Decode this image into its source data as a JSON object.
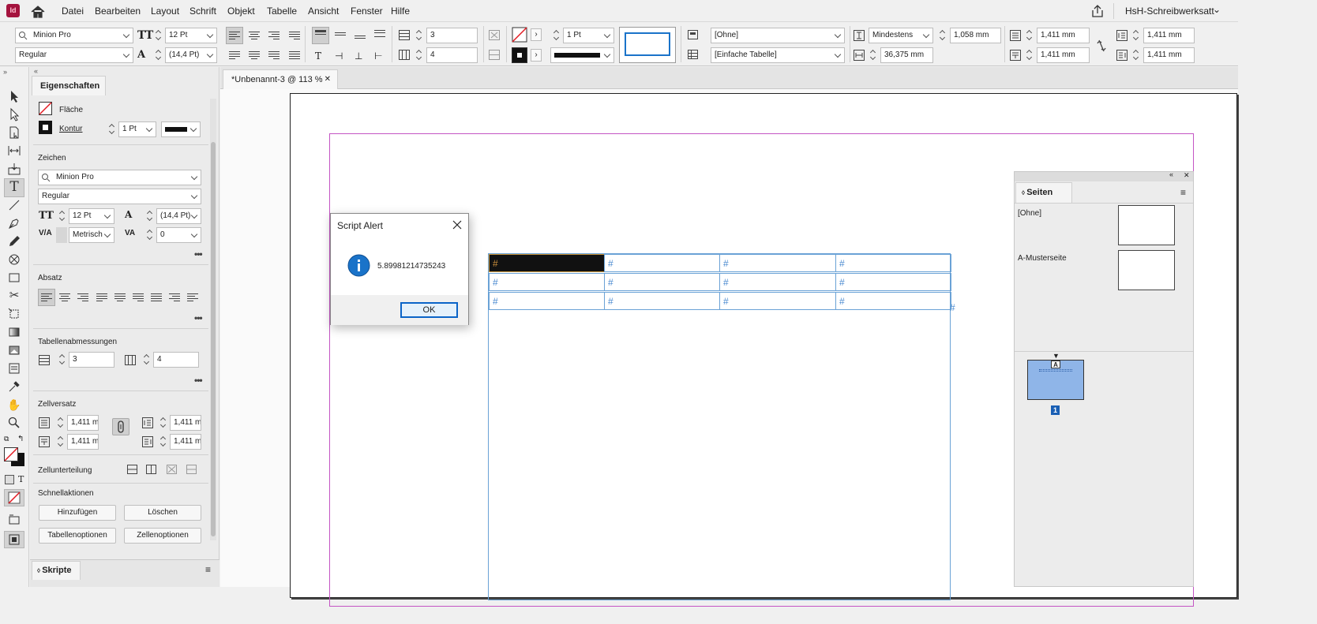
{
  "menubar": {
    "app_icon": "Id",
    "items": [
      "Datei",
      "Bearbeiten",
      "Layout",
      "Schrift",
      "Objekt",
      "Tabelle",
      "Ansicht",
      "Fenster",
      "Hilfe"
    ],
    "workspace": "HsH-Schreibwerksatt"
  },
  "control": {
    "font_family": "Minion Pro",
    "font_style": "Regular",
    "font_size": "12 Pt",
    "leading": "(14,4 Pt)",
    "rows": "3",
    "columns": "4",
    "stroke_weight": "1 Pt",
    "cell_style": "[Ohne]",
    "table_style": "[Einfache Tabelle]",
    "row_height_mode": "Mindestens",
    "row_height": "1,058 mm",
    "column_width": "36,375 mm",
    "inset_top": "1,411 mm",
    "inset_bottom": "1,411 mm",
    "inset_left": "1,411 mm",
    "inset_right": "1,411 mm"
  },
  "properties": {
    "tab": "Eigenschaften",
    "fill_label": "Fläche",
    "stroke_label": "Kontur",
    "stroke_weight": "1 Pt",
    "character_heading": "Zeichen",
    "font_family": "Minion Pro",
    "font_style": "Regular",
    "font_size": "12 Pt",
    "leading": "(14,4 Pt)",
    "kerning": "Metrisch",
    "tracking": "0",
    "paragraph_heading": "Absatz",
    "table_dims_heading": "Tabellenabmessungen",
    "rows": "3",
    "columns": "4",
    "cell_inset_heading": "Zellversatz",
    "inset_top": "1,411 m",
    "inset_bottom": "1,411 m",
    "inset_left": "1,411 m",
    "inset_right": "1,411 m",
    "cell_split_label": "Zellunterteilung",
    "quick_actions_heading": "Schnellaktionen",
    "add_button": "Hinzufügen",
    "delete_button": "Löschen",
    "table_options_button": "Tabellenoptionen",
    "cell_options_button": "Zellenoptionen",
    "scripts_tab": "Skripte"
  },
  "document": {
    "tab_title": "*Unbenannt-3 @ 113 %",
    "cell_marker": "#"
  },
  "pages_panel": {
    "title": "Seiten",
    "none_master": "[Ohne]",
    "a_master": "A-Musterseite",
    "page_master_letter": "A",
    "page_number": "1"
  },
  "dialog": {
    "title": "Script Alert",
    "message": "5.89981214735243",
    "ok_button": "OK"
  },
  "colors": {
    "accent": "#1a73c9",
    "frame_magenta": "#c455c4",
    "table_blue": "#6aa2d6",
    "page_thumb": "#8fb5e8",
    "info_icon": "#1a73c9"
  }
}
